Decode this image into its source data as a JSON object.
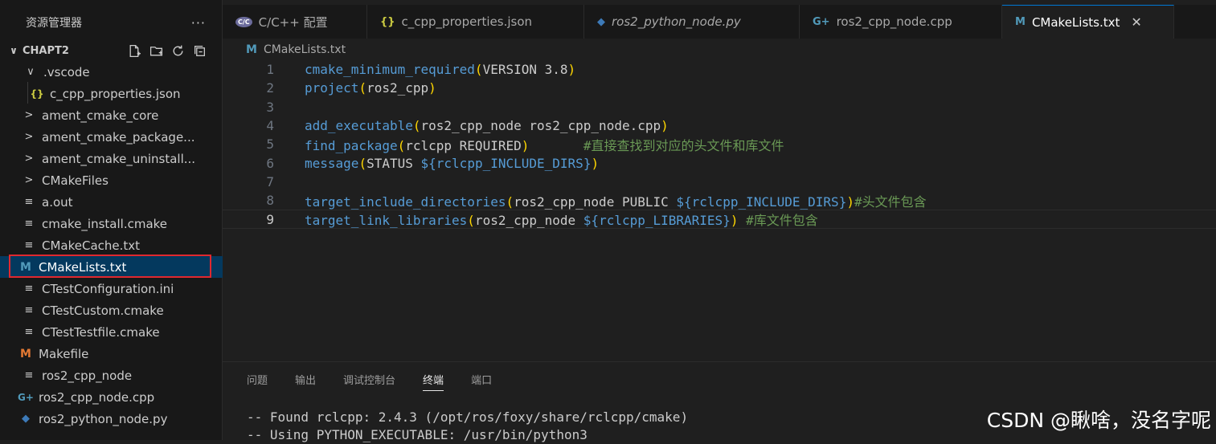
{
  "sidebar": {
    "title": "资源管理器",
    "more": "···",
    "section": "CHAPT2",
    "items": [
      {
        "label": ".vscode",
        "icon": "chevron-down-icon"
      },
      {
        "label": "c_cpp_properties.json",
        "icon": "json-icon"
      },
      {
        "label": "ament_cmake_core",
        "icon": "chevron-right-icon"
      },
      {
        "label": "ament_cmake_package...",
        "icon": "chevron-right-icon"
      },
      {
        "label": "ament_cmake_uninstall...",
        "icon": "chevron-right-icon"
      },
      {
        "label": "CMakeFiles",
        "icon": "chevron-right-icon"
      },
      {
        "label": "a.out",
        "icon": "lines-icon"
      },
      {
        "label": "cmake_install.cmake",
        "icon": "lines-icon"
      },
      {
        "label": "CMakeCache.txt",
        "icon": "lines-icon"
      },
      {
        "label": "CMakeLists.txt",
        "icon": "cmake-m-icon"
      },
      {
        "label": "CTestConfiguration.ini",
        "icon": "lines-icon"
      },
      {
        "label": "CTestCustom.cmake",
        "icon": "lines-icon"
      },
      {
        "label": "CTestTestfile.cmake",
        "icon": "lines-icon"
      },
      {
        "label": "Makefile",
        "icon": "makefile-m-icon"
      },
      {
        "label": "ros2_cpp_node",
        "icon": "lines-icon"
      },
      {
        "label": "ros2_cpp_node.cpp",
        "icon": "cpp-icon"
      },
      {
        "label": "ros2_python_node.py",
        "icon": "python-icon"
      }
    ]
  },
  "tabs": [
    {
      "label": "C/C++ 配置",
      "icon": "cpp-config-icon"
    },
    {
      "label": "c_cpp_properties.json",
      "icon": "json-icon"
    },
    {
      "label": "ros2_python_node.py",
      "icon": "python-icon"
    },
    {
      "label": "ros2_cpp_node.cpp",
      "icon": "cpp-icon"
    },
    {
      "label": "CMakeLists.txt",
      "icon": "cmake-m-icon",
      "close": "✕"
    }
  ],
  "breadcrumb": "CMakeLists.txt",
  "editor": {
    "line_numbers": [
      "1",
      "2",
      "3",
      "4",
      "5",
      "6",
      "7",
      "8",
      "9"
    ],
    "l1": {
      "fn": "cmake_minimum_required",
      "o": "(",
      "args": "VERSION 3.8",
      "c": ")"
    },
    "l2": {
      "fn": "project",
      "o": "(",
      "args": "ros2_cpp",
      "c": ")"
    },
    "l4": {
      "fn": "add_executable",
      "o": "(",
      "args": "ros2_cpp_node ros2_cpp_node.cpp",
      "c": ")"
    },
    "l5": {
      "fn": "find_package",
      "o": "(",
      "args": "rclcpp REQUIRED",
      "c": ")",
      "gap": "       ",
      "comment": "#直接查找到对应的头文件和库文件"
    },
    "l6": {
      "fn": "message",
      "o": "(",
      "args": "STATUS ",
      "var": "${",
      "vo": "",
      "vname": "rclcpp_INCLUDE_DIRS",
      "vc": "}",
      "c": ")"
    },
    "l8": {
      "fn": "target_include_directories",
      "o": "(",
      "args": "ros2_cpp_node PUBLIC ",
      "var": "${",
      "vname": "rclcpp_INCLUDE_DIRS",
      "vc": "}",
      "c": ")",
      "comment": "#头文件包含"
    },
    "l9": {
      "fn": "target_link_libraries",
      "o": "(",
      "args": "ros2_cpp_node ",
      "var": "${",
      "vname": "rclcpp_LIBRARIES",
      "vc": "}",
      "c": ")",
      "gap": " ",
      "comment": "#库文件包含"
    }
  },
  "panel": {
    "tabs": [
      "问题",
      "输出",
      "调试控制台",
      "终端",
      "端口"
    ],
    "active": "终端",
    "lines": [
      "-- Found rclcpp: 2.4.3 (/opt/ros/foxy/share/rclcpp/cmake)",
      "-- Using PYTHON_EXECUTABLE: /usr/bin/python3"
    ]
  },
  "watermark": "CSDN @瞅啥，没名字呢",
  "colors": {
    "accent": "#0078d4",
    "selection": "#04395e",
    "highlight_box": "#e0282f"
  }
}
